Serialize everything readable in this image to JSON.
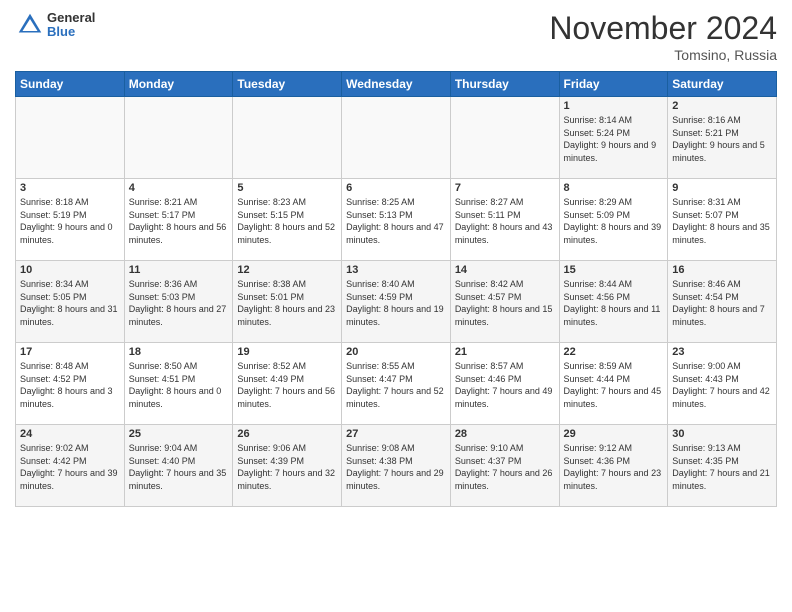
{
  "header": {
    "logo_general": "General",
    "logo_blue": "Blue",
    "month_title": "November 2024",
    "location": "Tomsino, Russia"
  },
  "days_of_week": [
    "Sunday",
    "Monday",
    "Tuesday",
    "Wednesday",
    "Thursday",
    "Friday",
    "Saturday"
  ],
  "weeks": [
    [
      {
        "day": "",
        "info": ""
      },
      {
        "day": "",
        "info": ""
      },
      {
        "day": "",
        "info": ""
      },
      {
        "day": "",
        "info": ""
      },
      {
        "day": "",
        "info": ""
      },
      {
        "day": "1",
        "info": "Sunrise: 8:14 AM\nSunset: 5:24 PM\nDaylight: 9 hours and 9 minutes."
      },
      {
        "day": "2",
        "info": "Sunrise: 8:16 AM\nSunset: 5:21 PM\nDaylight: 9 hours and 5 minutes."
      }
    ],
    [
      {
        "day": "3",
        "info": "Sunrise: 8:18 AM\nSunset: 5:19 PM\nDaylight: 9 hours and 0 minutes."
      },
      {
        "day": "4",
        "info": "Sunrise: 8:21 AM\nSunset: 5:17 PM\nDaylight: 8 hours and 56 minutes."
      },
      {
        "day": "5",
        "info": "Sunrise: 8:23 AM\nSunset: 5:15 PM\nDaylight: 8 hours and 52 minutes."
      },
      {
        "day": "6",
        "info": "Sunrise: 8:25 AM\nSunset: 5:13 PM\nDaylight: 8 hours and 47 minutes."
      },
      {
        "day": "7",
        "info": "Sunrise: 8:27 AM\nSunset: 5:11 PM\nDaylight: 8 hours and 43 minutes."
      },
      {
        "day": "8",
        "info": "Sunrise: 8:29 AM\nSunset: 5:09 PM\nDaylight: 8 hours and 39 minutes."
      },
      {
        "day": "9",
        "info": "Sunrise: 8:31 AM\nSunset: 5:07 PM\nDaylight: 8 hours and 35 minutes."
      }
    ],
    [
      {
        "day": "10",
        "info": "Sunrise: 8:34 AM\nSunset: 5:05 PM\nDaylight: 8 hours and 31 minutes."
      },
      {
        "day": "11",
        "info": "Sunrise: 8:36 AM\nSunset: 5:03 PM\nDaylight: 8 hours and 27 minutes."
      },
      {
        "day": "12",
        "info": "Sunrise: 8:38 AM\nSunset: 5:01 PM\nDaylight: 8 hours and 23 minutes."
      },
      {
        "day": "13",
        "info": "Sunrise: 8:40 AM\nSunset: 4:59 PM\nDaylight: 8 hours and 19 minutes."
      },
      {
        "day": "14",
        "info": "Sunrise: 8:42 AM\nSunset: 4:57 PM\nDaylight: 8 hours and 15 minutes."
      },
      {
        "day": "15",
        "info": "Sunrise: 8:44 AM\nSunset: 4:56 PM\nDaylight: 8 hours and 11 minutes."
      },
      {
        "day": "16",
        "info": "Sunrise: 8:46 AM\nSunset: 4:54 PM\nDaylight: 8 hours and 7 minutes."
      }
    ],
    [
      {
        "day": "17",
        "info": "Sunrise: 8:48 AM\nSunset: 4:52 PM\nDaylight: 8 hours and 3 minutes."
      },
      {
        "day": "18",
        "info": "Sunrise: 8:50 AM\nSunset: 4:51 PM\nDaylight: 8 hours and 0 minutes."
      },
      {
        "day": "19",
        "info": "Sunrise: 8:52 AM\nSunset: 4:49 PM\nDaylight: 7 hours and 56 minutes."
      },
      {
        "day": "20",
        "info": "Sunrise: 8:55 AM\nSunset: 4:47 PM\nDaylight: 7 hours and 52 minutes."
      },
      {
        "day": "21",
        "info": "Sunrise: 8:57 AM\nSunset: 4:46 PM\nDaylight: 7 hours and 49 minutes."
      },
      {
        "day": "22",
        "info": "Sunrise: 8:59 AM\nSunset: 4:44 PM\nDaylight: 7 hours and 45 minutes."
      },
      {
        "day": "23",
        "info": "Sunrise: 9:00 AM\nSunset: 4:43 PM\nDaylight: 7 hours and 42 minutes."
      }
    ],
    [
      {
        "day": "24",
        "info": "Sunrise: 9:02 AM\nSunset: 4:42 PM\nDaylight: 7 hours and 39 minutes."
      },
      {
        "day": "25",
        "info": "Sunrise: 9:04 AM\nSunset: 4:40 PM\nDaylight: 7 hours and 35 minutes."
      },
      {
        "day": "26",
        "info": "Sunrise: 9:06 AM\nSunset: 4:39 PM\nDaylight: 7 hours and 32 minutes."
      },
      {
        "day": "27",
        "info": "Sunrise: 9:08 AM\nSunset: 4:38 PM\nDaylight: 7 hours and 29 minutes."
      },
      {
        "day": "28",
        "info": "Sunrise: 9:10 AM\nSunset: 4:37 PM\nDaylight: 7 hours and 26 minutes."
      },
      {
        "day": "29",
        "info": "Sunrise: 9:12 AM\nSunset: 4:36 PM\nDaylight: 7 hours and 23 minutes."
      },
      {
        "day": "30",
        "info": "Sunrise: 9:13 AM\nSunset: 4:35 PM\nDaylight: 7 hours and 21 minutes."
      }
    ]
  ]
}
